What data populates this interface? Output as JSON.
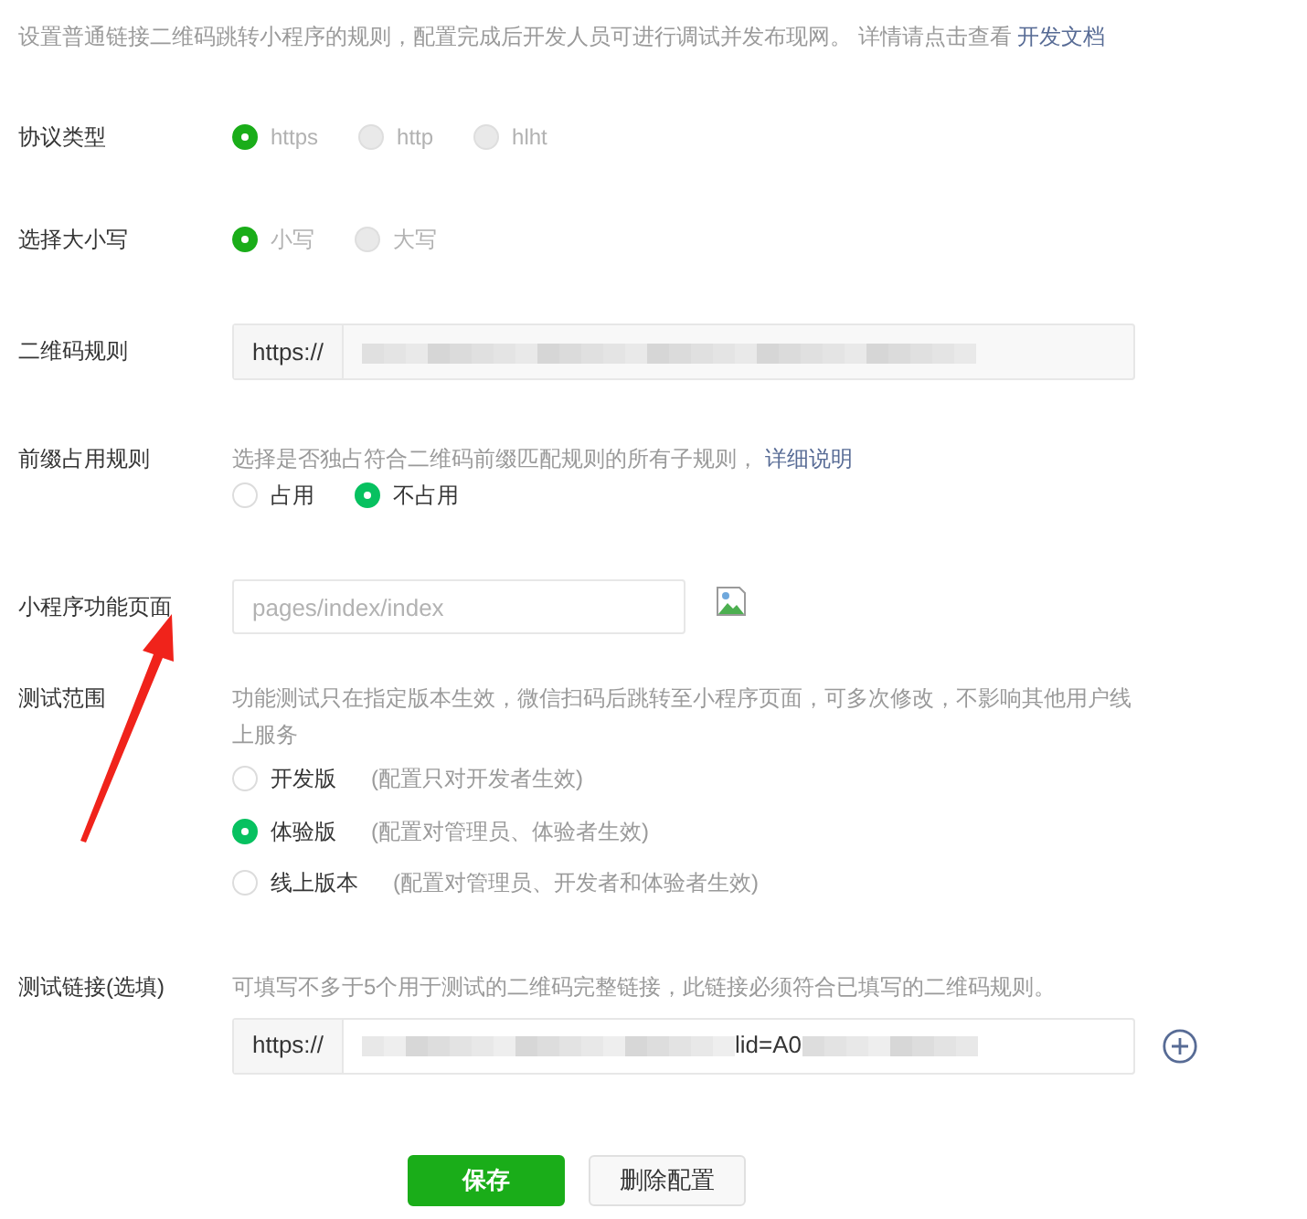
{
  "description": {
    "text": "设置普通链接二维码跳转小程序的规则，配置完成后开发人员可进行调试并发布现网。 详情请点击查看",
    "link": "开发文档"
  },
  "fields": [
    {
      "kind": "radio",
      "label": "协议类型",
      "disabled": true,
      "stacked": false,
      "options": [
        {
          "label": "https",
          "selected": true
        },
        {
          "label": "http",
          "selected": false
        },
        {
          "label": "hlht",
          "selected": false
        }
      ]
    },
    {
      "kind": "radio",
      "label": "选择大小写",
      "disabled": true,
      "stacked": false,
      "options": [
        {
          "label": "小写",
          "selected": true
        },
        {
          "label": "大写",
          "selected": false
        }
      ]
    },
    {
      "kind": "prefixed",
      "label": "二维码规则",
      "prefix": "https://"
    },
    {
      "kind": "radio",
      "label": "前缀占用规则",
      "hint": "选择是否独占符合二维码前缀匹配规则的所有子规则，",
      "hint_link": "详细说明",
      "disabled": false,
      "stacked": false,
      "options": [
        {
          "label": "占用",
          "selected": false
        },
        {
          "label": "不占用",
          "selected": true
        }
      ]
    },
    {
      "kind": "text",
      "label": "小程序功能页面",
      "placeholder": "pages/index/index"
    },
    {
      "kind": "radio",
      "label": "测试范围",
      "hint": "功能测试只在指定版本生效，微信扫码后跳转至小程序页面，可多次修改，不影响其他用户线上服务",
      "disabled": false,
      "stacked": true,
      "options": [
        {
          "label": "开发版",
          "note": "(配置只对开发者生效)",
          "selected": false
        },
        {
          "label": "体验版",
          "note": "(配置对管理员、体验者生效)",
          "selected": true
        },
        {
          "label": "线上版本",
          "note": "(配置对管理员、开发者和体验者生效)",
          "selected": false
        }
      ]
    },
    {
      "kind": "prefixed",
      "label": "测试链接(选填)",
      "hint": "可填写不多于5个用于测试的二维码完整链接，此链接必须符合已填写的二维码规则。",
      "prefix": "https://",
      "value": "lid=A0",
      "addable": true
    }
  ],
  "buttons": [
    {
      "label": "保存",
      "kind": "primary"
    },
    {
      "label": "删除配置",
      "kind": "secondary"
    }
  ]
}
